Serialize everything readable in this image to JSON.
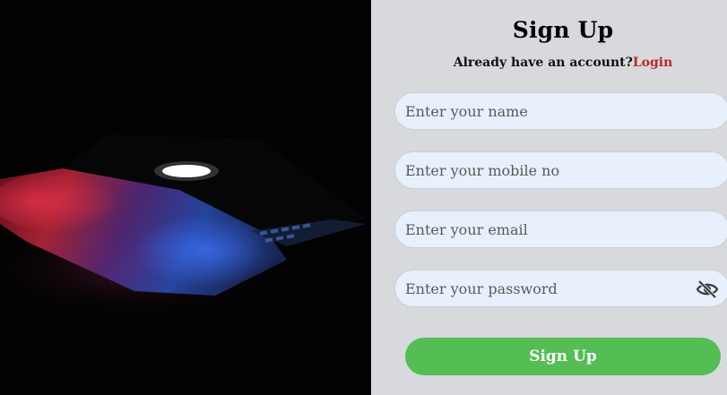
{
  "hero": {
    "image": "laptop-dark-photo"
  },
  "form": {
    "title": "Sign Up",
    "subtitle_text": "Already have an account?",
    "login_link": "Login",
    "fields": [
      {
        "placeholder": "Enter your name",
        "value": ""
      },
      {
        "placeholder": "Enter your mobile no",
        "value": ""
      },
      {
        "placeholder": "Enter your email",
        "value": ""
      },
      {
        "placeholder": "Enter your password",
        "value": ""
      }
    ],
    "password_toggle_icon": "eye-slash-icon",
    "submit_label": "Sign Up"
  },
  "colors": {
    "panel_bg": "#d8d9dd",
    "field_bg": "#e8f1fb",
    "link": "#b52a2a",
    "button": "#54bd54"
  }
}
